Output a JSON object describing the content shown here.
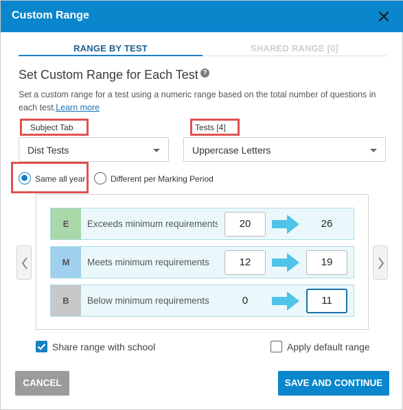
{
  "dialog": {
    "title": "Custom Range",
    "close_icon": "close-icon"
  },
  "tabs": [
    {
      "label": "RANGE BY TEST",
      "active": true
    },
    {
      "label": "SHARED RANGE [0]",
      "active": false
    }
  ],
  "heading": "Set Custom Range for Each Test",
  "help_icon_glyph": "?",
  "description": "Set a custom range for a test using a numeric range based on the total number of questions in each test.",
  "learn_more": "Learn more",
  "subject_tab": {
    "label": "Subject Tab",
    "value": "Dist Tests"
  },
  "tests": {
    "label": "Tests [4]",
    "value": "Uppercase Letters"
  },
  "period": {
    "options": [
      "Same all year",
      "Different per Marking Period"
    ],
    "selected": "Same all year"
  },
  "ranges": [
    {
      "letter": "E",
      "label": "Exceeds minimum requirements",
      "min": "20",
      "max": "26",
      "color": "#a8d8a8"
    },
    {
      "letter": "M",
      "label": "Meets minimum requirements",
      "min": "12",
      "max": "19",
      "color": "#9fd1ef"
    },
    {
      "letter": "B",
      "label": "Below minimum requirements",
      "min": "0",
      "max": "11",
      "color": "#c8c8c8"
    }
  ],
  "options": {
    "share_range": {
      "label": "Share range with school",
      "checked": true
    },
    "apply_default": {
      "label": "Apply default range",
      "checked": false
    }
  },
  "buttons": {
    "cancel": "CANCEL",
    "save": "SAVE AND CONTINUE"
  },
  "colors": {
    "primary": "#0a86cc",
    "highlight": "#e05050",
    "row_bg": "#eaf8fb",
    "arrow": "#4fc3e8"
  }
}
